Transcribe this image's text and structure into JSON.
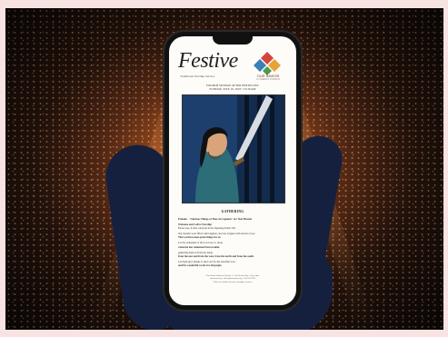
{
  "bulletin": {
    "brand_title": "Festive",
    "brand_subtitle": "Traditional Worship Service",
    "church_logo_text": "OUR SAVIOR",
    "church_logo_sub": "LUTHERAN CHURCH",
    "event_line_1": "FOURTH SUNDAY AFTER PENTECOST",
    "event_line_2": "SUNDAY, JULY 16, 2023 • 10:30 AM",
    "section_title": "GATHERING",
    "lines": [
      {
        "text": "Prelude - \"Glorious Things of Thee Are Spoken\" arr. Don Hustad",
        "bold": true
      },
      {
        "text": "Welcome and Call to Worship",
        "bold": true
      },
      {
        "text": "Please rise, if able, and join in the Opening Psalm 126:",
        "bold": false
      },
      {
        "text": "Our mouths were filled with laughter, and our tongues with shouts of joy.",
        "bold": false
      },
      {
        "text": "The Lord has done great things for us.",
        "bold": true
      },
      {
        "text": "Let the redeemed of the Lord say so, those",
        "bold": false
      },
      {
        "text": "whom he has redeemed from trouble.",
        "bold": true
      },
      {
        "text": "gathering them in from the lands,",
        "bold": false
      },
      {
        "text": "from the east and from the west, from the north and from the south.",
        "bold": true
      },
      {
        "text": "Let them give thanks to the Lord for his steadfast love,",
        "bold": false
      },
      {
        "text": "and his wonderful works for all people.",
        "bold": true
      }
    ],
    "footer_lines": [
      "Our Savior Lutheran Church • 1 Our Savior Way • City, State",
      "oursavior.org • office@oursavior.org • 555.555.5555",
      "Visit our website for more worship resources"
    ]
  },
  "colors": {
    "page_border": "#f7e3e2",
    "background_glow": "#c8742c",
    "hand": "#15203f",
    "phone_bezel": "#111111",
    "screen": "#fdfcf8",
    "art_blue": "#1b3a66"
  },
  "icons": [
    "church-logo-icon"
  ]
}
